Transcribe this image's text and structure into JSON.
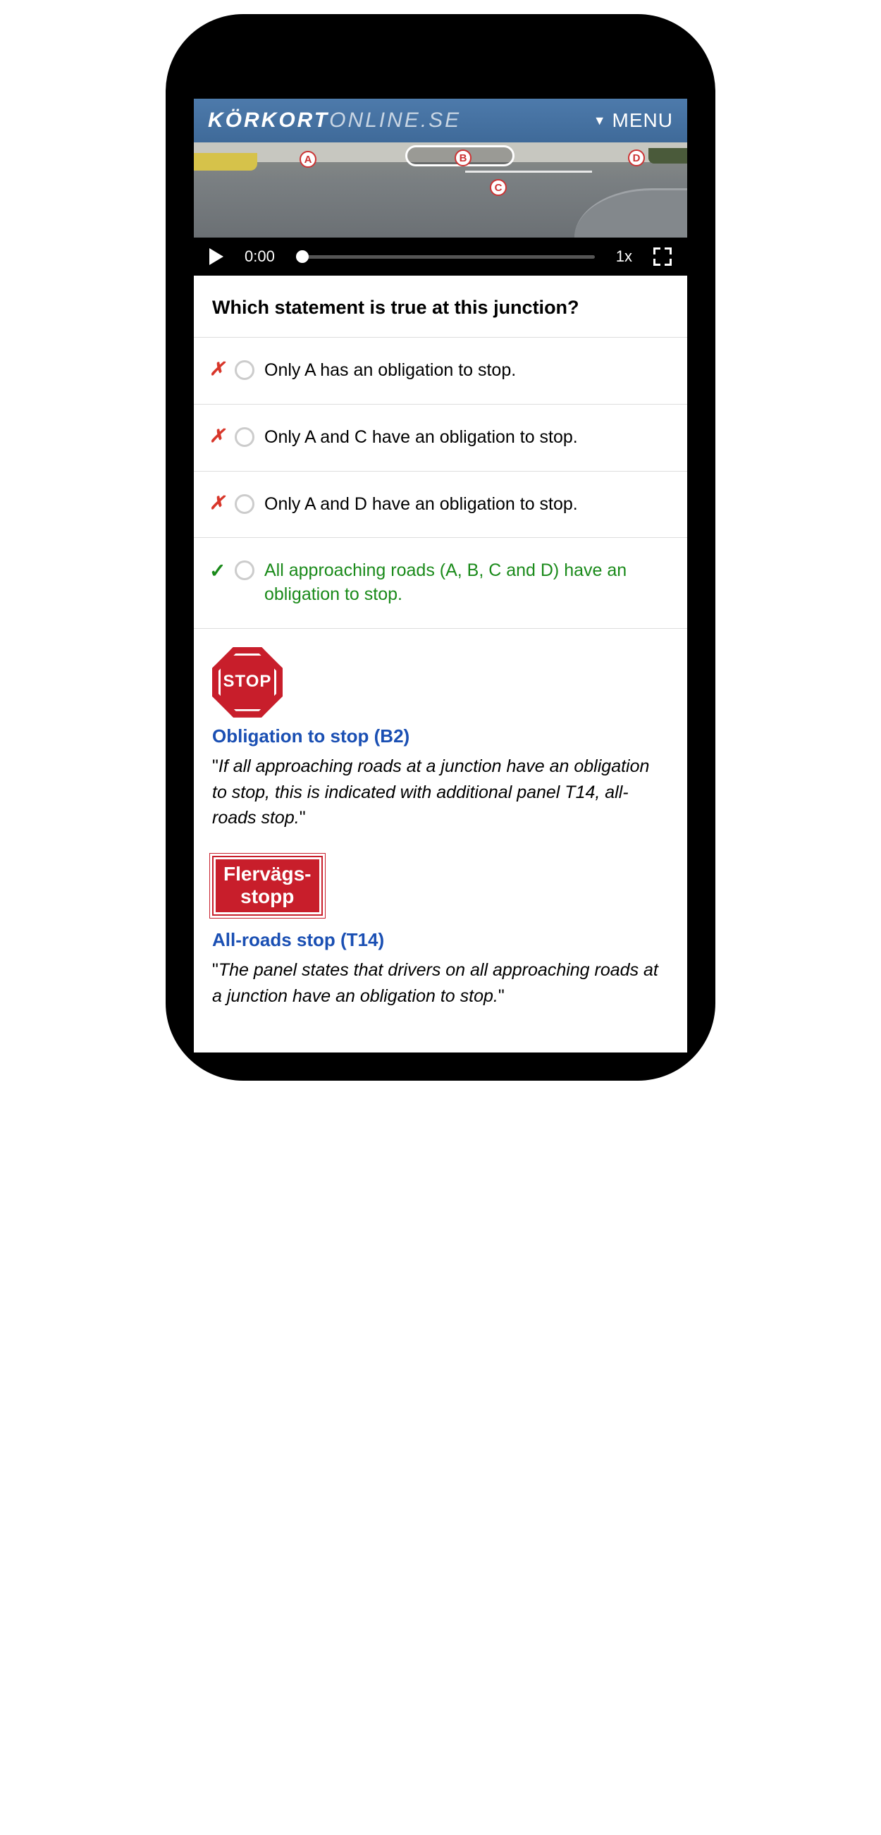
{
  "header": {
    "logo_bold": "KÖRKORT",
    "logo_light": "ONLINE.SE",
    "menu_label": "MENU"
  },
  "video": {
    "markers": {
      "A": "A",
      "B": "B",
      "C": "C",
      "D": "D"
    },
    "time": "0:00",
    "speed": "1x"
  },
  "question": "Which statement is true at this junction?",
  "options": [
    {
      "mark": "✗",
      "correct": false,
      "text": "Only A has an obligation to stop."
    },
    {
      "mark": "✗",
      "correct": false,
      "text": "Only A and C have an obligation to stop."
    },
    {
      "mark": "✗",
      "correct": false,
      "text": "Only A and D have an obligation to stop."
    },
    {
      "mark": "✓",
      "correct": true,
      "text": "All approaching roads (A, B, C and D) have an obligation to stop."
    }
  ],
  "explanations": [
    {
      "sign_label": "STOP",
      "title": "Obligation to stop (B2)",
      "desc": "If all approaching roads at a junction have an obligation to stop, this is indicated with additional panel T14, all-roads stop."
    },
    {
      "sign_label": "Flervägs-\nstopp",
      "title": "All-roads stop (T14)",
      "desc": "The panel states that drivers on all approaching roads at a junction have an obligation to stop."
    }
  ]
}
